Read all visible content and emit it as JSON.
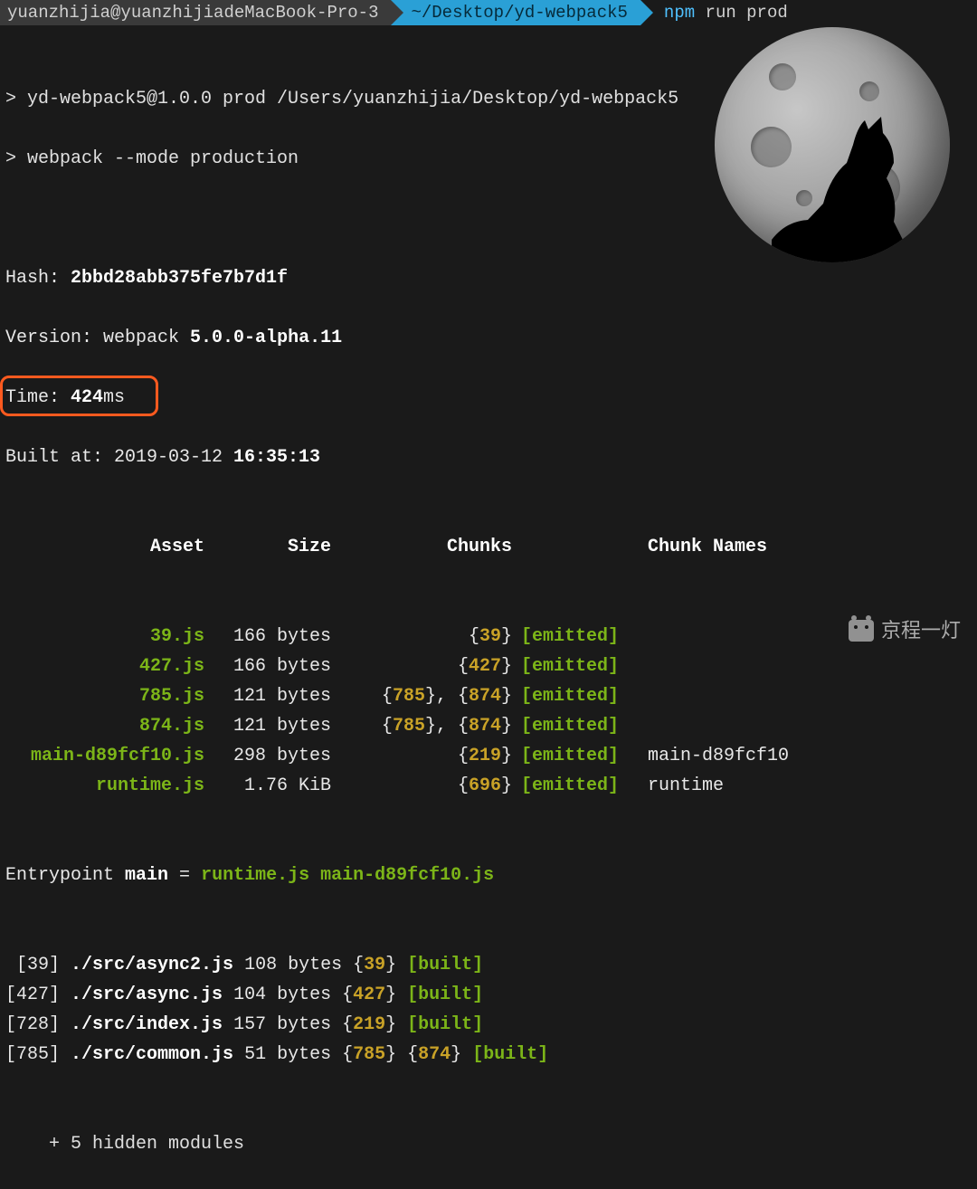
{
  "prompt": {
    "user": "yuanzhijia@yuanzhijiadeMacBook-Pro-3",
    "path": "~/Desktop/yd-webpack5",
    "cmd_bin": "npm",
    "cmd_rest": " run prod"
  },
  "run": {
    "line1": "> yd-webpack5@1.0.0 prod /Users/yuanzhijia/Desktop/yd-webpack5",
    "line2": "> webpack --mode production"
  },
  "stats": {
    "hash_label": "Hash: ",
    "hash": "2bbd28abb375fe7b7d1f",
    "version_label": "Version: webpack ",
    "version": "5.0.0-alpha.11",
    "time_label": "Time: ",
    "time": "424",
    "time_unit": "ms",
    "built_label": "Built at: 2019-03-12 ",
    "built_time": "16:35:13"
  },
  "headers": {
    "asset": "Asset",
    "size": "Size",
    "chunks": "Chunks",
    "chunk_names": "Chunk Names"
  },
  "assets": [
    {
      "name": "39.js",
      "size": "166 bytes",
      "chunks": "{39}",
      "emitted": "[emitted]",
      "cname": ""
    },
    {
      "name": "427.js",
      "size": "166 bytes",
      "chunks": "{427}",
      "emitted": "[emitted]",
      "cname": ""
    },
    {
      "name": "785.js",
      "size": "121 bytes",
      "chunks": "{785}, {874}",
      "emitted": "[emitted]",
      "cname": ""
    },
    {
      "name": "874.js",
      "size": "121 bytes",
      "chunks": "{785}, {874}",
      "emitted": "[emitted]",
      "cname": ""
    },
    {
      "name": "main-d89fcf10.js",
      "size": "298 bytes",
      "chunks": "{219}",
      "emitted": "[emitted]",
      "cname": "main-d89fcf10"
    },
    {
      "name": "runtime.js",
      "size": "1.76 KiB",
      "chunks": "{696}",
      "emitted": "[emitted]",
      "cname": "runtime"
    }
  ],
  "entrypoint": {
    "label": "Entrypoint ",
    "name": "main",
    "eq": " = ",
    "files": "runtime.js main-d89fcf10.js"
  },
  "modules": [
    {
      "id": " [39]",
      "path": "./src/async2.js",
      "size": "108 bytes",
      "chunks": "{39}",
      "built": "[built]"
    },
    {
      "id": "[427]",
      "path": "./src/async.js",
      "size": "104 bytes",
      "chunks": "{427}",
      "built": "[built]"
    },
    {
      "id": "[728]",
      "path": "./src/index.js",
      "size": "157 bytes",
      "chunks": "{219}",
      "built": "[built]"
    },
    {
      "id": "[785]",
      "path": "./src/common.js",
      "size": "51 bytes",
      "chunks": "{785} {874}",
      "built": "[built]"
    }
  ],
  "hidden": "    + 5 hidden modules",
  "watermark": "京程一灯"
}
